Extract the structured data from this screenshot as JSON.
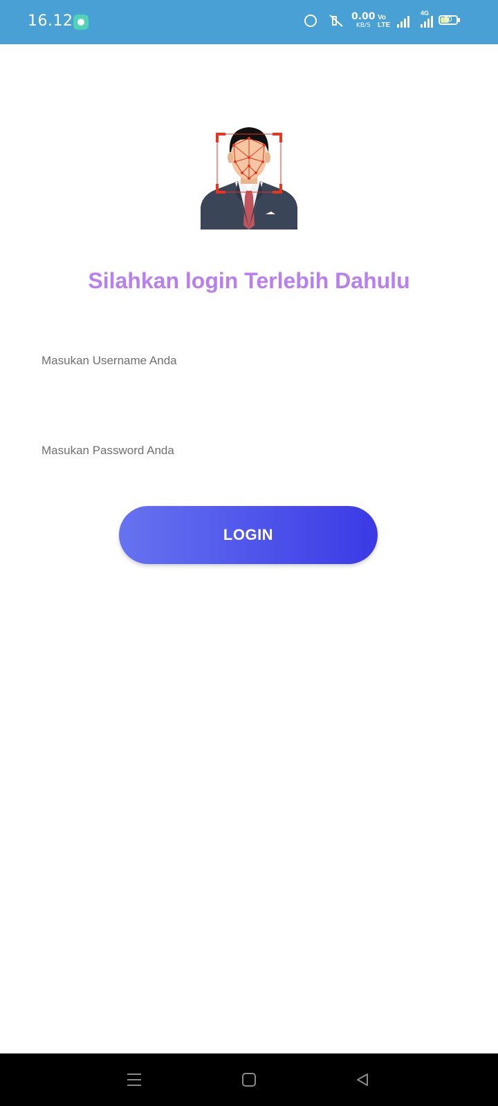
{
  "status_bar": {
    "time": "16.12",
    "net_speed_value": "0.00",
    "net_speed_unit": "KB/S",
    "volte_top": "Vo",
    "volte_bottom": "LTE",
    "network_type": "4G",
    "battery_level": "50",
    "icons": [
      "chat-icon",
      "alarm-icon",
      "mute-icon",
      "signal-icon",
      "battery-icon"
    ]
  },
  "login": {
    "avatar_icon": "face-recognition-avatar",
    "title": "Silahkan login Terlebih Dahulu",
    "username_placeholder": "Masukan Username Anda",
    "password_placeholder": "Masukan Password Anda",
    "button_label": "LOGIN"
  },
  "colors": {
    "status_bar_bg": "#49a0d5",
    "title": "#b77ff1",
    "button_start": "#6673f0",
    "button_end": "#3b3ae6",
    "scan_frame": "#e8361e"
  },
  "nav_bar": {
    "icons": [
      "menu-icon",
      "home-icon",
      "back-icon"
    ]
  }
}
